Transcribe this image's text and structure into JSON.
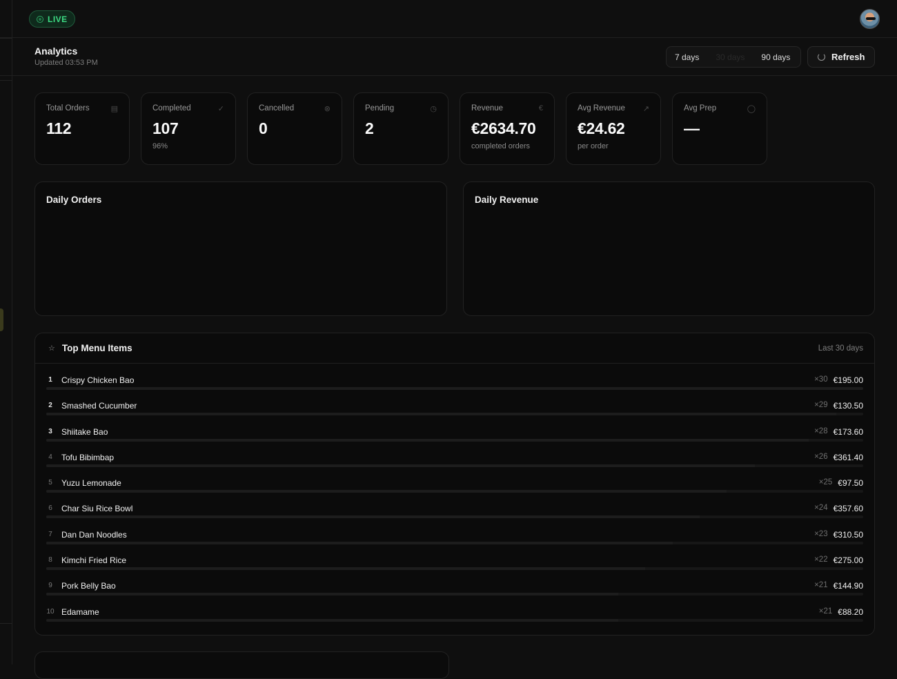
{
  "header": {
    "live_label": "LIVE",
    "avatar_icon": "user-avatar"
  },
  "subheader": {
    "title": "Analytics",
    "updated": "Updated 03:53 PM",
    "ranges": [
      "7 days",
      "30 days",
      "90 days"
    ],
    "active_range": "30 days",
    "refresh_label": "Refresh"
  },
  "kpis": [
    {
      "label": "Total Orders",
      "value": "112",
      "sub": "",
      "icon": "receipt-icon"
    },
    {
      "label": "Completed",
      "value": "107",
      "sub": "96%",
      "icon": "check-circle-icon"
    },
    {
      "label": "Cancelled",
      "value": "0",
      "sub": "",
      "icon": "x-circle-icon"
    },
    {
      "label": "Pending",
      "value": "2",
      "sub": "",
      "icon": "clock-icon"
    },
    {
      "label": "Revenue",
      "value": "€2634.70",
      "sub": "completed orders",
      "icon": "euro-icon"
    },
    {
      "label": "Avg Revenue",
      "value": "€24.62",
      "sub": "per order",
      "icon": "trending-up-icon"
    },
    {
      "label": "Avg Prep",
      "value": "—",
      "sub": "",
      "icon": "timer-icon"
    }
  ],
  "charts": {
    "orders_title": "Daily Orders",
    "revenue_title": "Daily Revenue"
  },
  "top_items": {
    "title": "Top Menu Items",
    "period": "Last 30 days",
    "items": [
      {
        "rank": "1",
        "name": "Crispy Chicken Bao",
        "qty": "×30",
        "amount": "€195.00",
        "share": 1.0
      },
      {
        "rank": "2",
        "name": "Smashed Cucumber",
        "qty": "×29",
        "amount": "€130.50",
        "share": 0.967
      },
      {
        "rank": "3",
        "name": "Shiitake Bao",
        "qty": "×28",
        "amount": "€173.60",
        "share": 0.933
      },
      {
        "rank": "4",
        "name": "Tofu Bibimbap",
        "qty": "×26",
        "amount": "€361.40",
        "share": 0.867
      },
      {
        "rank": "5",
        "name": "Yuzu Lemonade",
        "qty": "×25",
        "amount": "€97.50",
        "share": 0.833
      },
      {
        "rank": "6",
        "name": "Char Siu Rice Bowl",
        "qty": "×24",
        "amount": "€357.60",
        "share": 0.8
      },
      {
        "rank": "7",
        "name": "Dan Dan Noodles",
        "qty": "×23",
        "amount": "€310.50",
        "share": 0.767
      },
      {
        "rank": "8",
        "name": "Kimchi Fried Rice",
        "qty": "×22",
        "amount": "€275.00",
        "share": 0.733
      },
      {
        "rank": "9",
        "name": "Pork Belly Bao",
        "qty": "×21",
        "amount": "€144.90",
        "share": 0.7
      },
      {
        "rank": "10",
        "name": "Edamame",
        "qty": "×21",
        "amount": "€88.20",
        "share": 0.7
      }
    ]
  },
  "colors": {
    "background": "#0f0f0f",
    "card": "#0b0b0b",
    "live_accent": "#3ddc84"
  }
}
